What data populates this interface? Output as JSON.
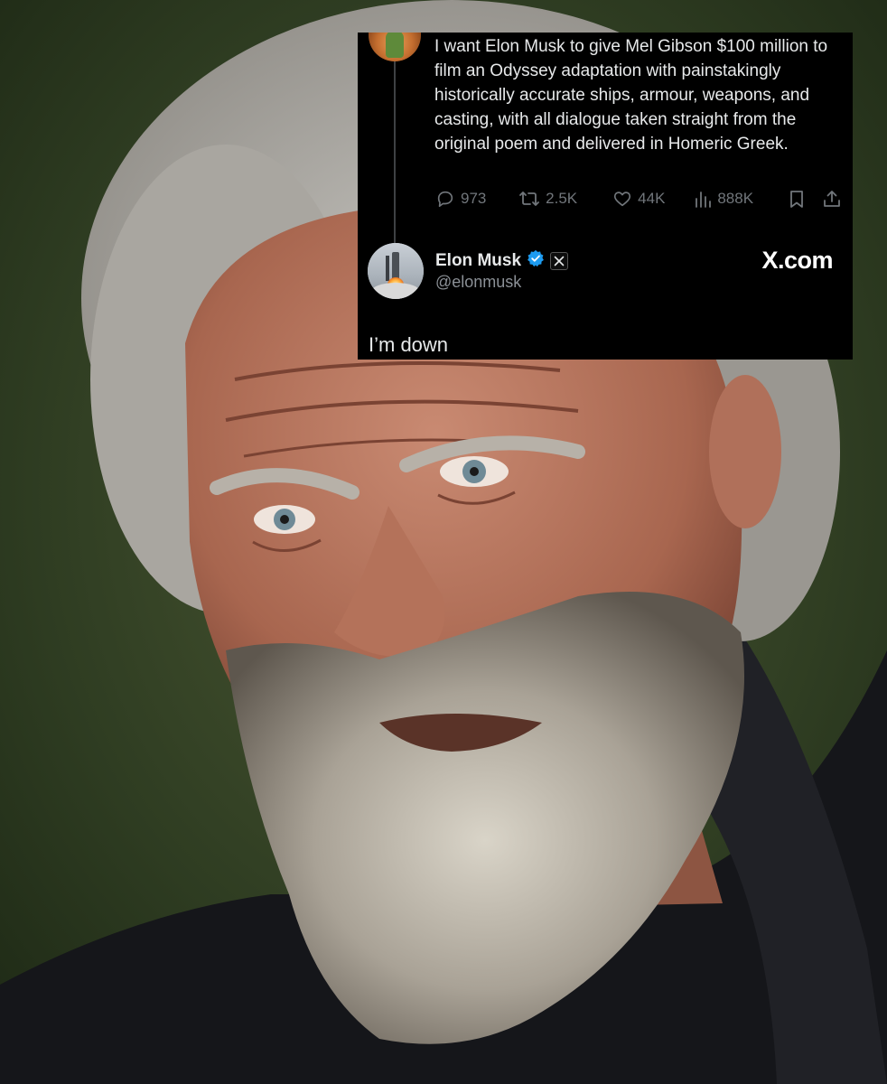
{
  "photo": {
    "subject_icon": "bearded-man-portrait"
  },
  "tweet": {
    "text": "I want Elon Musk to give Mel Gibson $100 million to film an Odyssey adaptation with painstakingly historically accurate ships, armour, weapons, and casting, with all dialogue taken straight from the original poem and delivered in Homeric Greek.",
    "stats": {
      "replies": "973",
      "reposts": "2.5K",
      "likes": "44K",
      "views": "888K"
    }
  },
  "reply": {
    "name": "Elon Musk",
    "handle": "@elonmusk",
    "text": "I’m down",
    "verified_color": "#1d9bf0"
  },
  "brand": {
    "label": "X.com"
  }
}
